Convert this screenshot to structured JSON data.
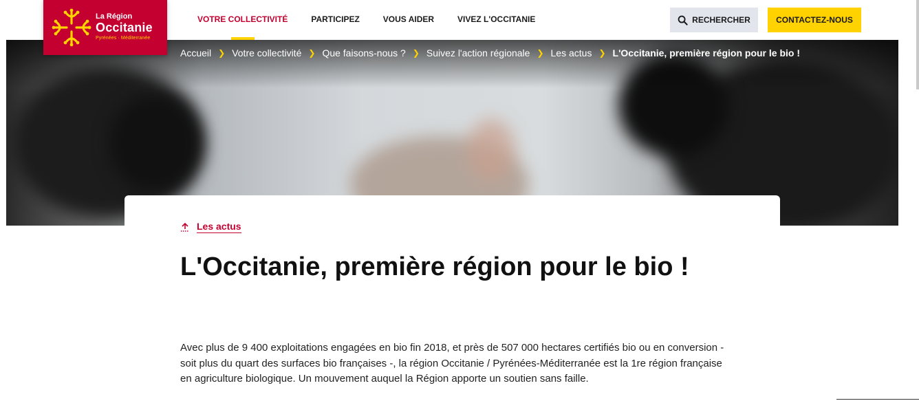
{
  "brand": {
    "line1": "La Région",
    "line2": "Occitanie",
    "line3": "Pyrénées · Méditerranée",
    "color": "#c3002f",
    "accent": "#ffd200"
  },
  "nav": {
    "items": [
      {
        "label": "VOTRE COLLECTIVITÉ",
        "active": true
      },
      {
        "label": "PARTICIPEZ"
      },
      {
        "label": "VOUS AIDER"
      },
      {
        "label": "VIVEZ L'OCCITANIE"
      }
    ]
  },
  "header_actions": {
    "search_label": "RECHERCHER",
    "search_icon": "search-icon",
    "contact_label": "CONTACTEZ-NOUS"
  },
  "breadcrumb": {
    "items": [
      "Accueil",
      "Votre collectivité",
      "Que faisons-nous ?",
      "Suivez l'action régionale",
      "Les actus"
    ],
    "current": "L'Occitanie, première région pour le bio !"
  },
  "article": {
    "back_label": "Les actus",
    "back_icon": "arrow-up-icon",
    "title": "L'Occitanie, première région pour le bio !",
    "lead": "Avec plus de 9 400 exploitations engagées en bio fin 2018, et près de 507 000 hectares certifiés bio ou en conversion - soit plus du quart des surfaces bio françaises -, la région Occitanie / Pyrénées-Méditerranée est la 1re région française en agriculture biologique. Un mouvement auquel la Région apporte un soutien sans faille."
  }
}
